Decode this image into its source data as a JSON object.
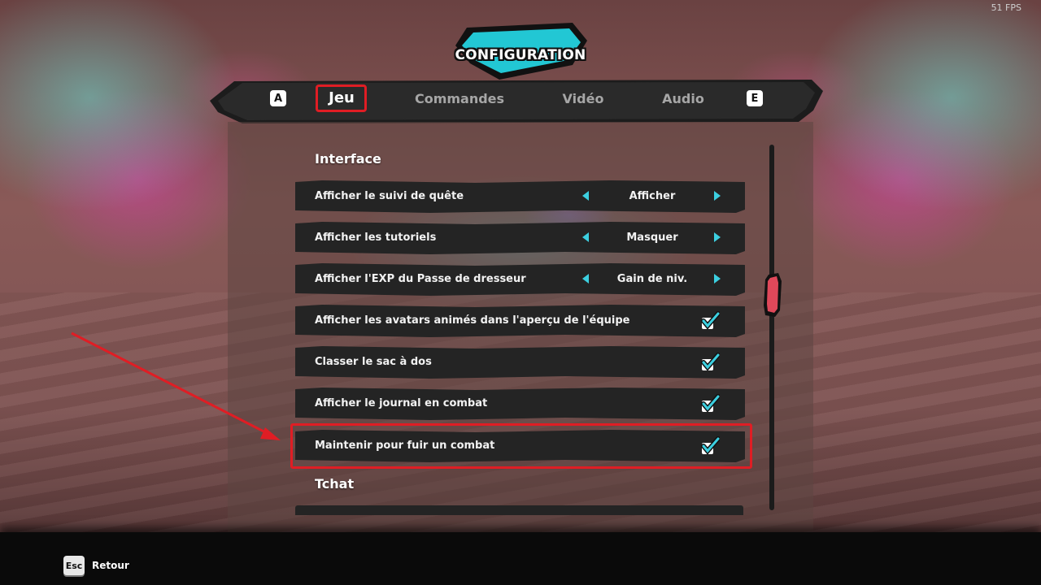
{
  "fps": "51 FPS",
  "header": {
    "title": "CONFIGURATION"
  },
  "tabs": {
    "prev_key": "A",
    "next_key": "E",
    "items": [
      "Jeu",
      "Commandes",
      "Vidéo",
      "Audio"
    ],
    "active": "Jeu"
  },
  "sections": {
    "interface": "Interface",
    "tchat": "Tchat"
  },
  "settings": [
    {
      "label": "Afficher le suivi de quête",
      "type": "select",
      "value": "Afficher"
    },
    {
      "label": "Afficher les tutoriels",
      "type": "select",
      "value": "Masquer"
    },
    {
      "label": "Afficher l'EXP du Passe de dresseur",
      "type": "select",
      "value": "Gain de niv."
    },
    {
      "label": "Afficher les avatars animés dans l'aperçu de l'équipe",
      "type": "checkbox",
      "checked": true
    },
    {
      "label": "Classer le sac à dos",
      "type": "checkbox",
      "checked": true
    },
    {
      "label": "Afficher le journal en combat",
      "type": "checkbox",
      "checked": true
    },
    {
      "label": "Maintenir pour fuir un combat",
      "type": "checkbox",
      "checked": true
    }
  ],
  "footer": {
    "esc_key": "Esc",
    "back_label": "Retour"
  },
  "colors": {
    "accent": "#3ccfe0",
    "highlight": "#e01d24",
    "row_bg": "#242424",
    "thumb": "#e0485a"
  }
}
